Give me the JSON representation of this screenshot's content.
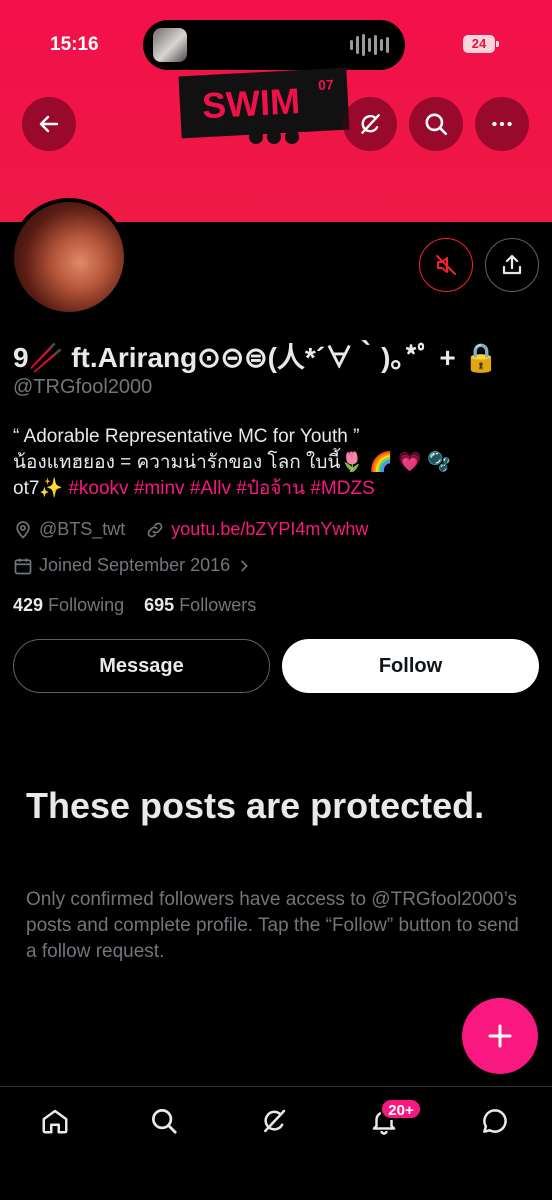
{
  "status_bar": {
    "time": "15:16",
    "battery": "24"
  },
  "banner": {
    "logo_text": "SWIM",
    "logo_sup": "07"
  },
  "profile": {
    "name": "9🥢 ft.Arirang⊙⊝⊜(人*´∀｀)｡*ﾟ + 🔒",
    "handle": "@TRGfool2000",
    "bio_line1": "“ Adorable Representative MC for Youth ”",
    "bio_line2": "น้องแทฮยอง = ความน่ารักของ โลก ใบนี้🌷 🌈 💗 🫧",
    "bio_line3_prefix": "ot7✨ ",
    "bio_tags": "#kookv #minv #Allv #ป๋อจ้าน #MDZS",
    "location": "@BTS_twt",
    "website": "youtu.be/bZYPI4mYwhw",
    "joined": "Joined September 2016",
    "following_count": "429",
    "following_label": "Following",
    "followers_count": "695",
    "followers_label": "Followers"
  },
  "buttons": {
    "message": "Message",
    "follow": "Follow"
  },
  "protected": {
    "title": "These posts are protected.",
    "body": "Only confirmed followers have access to @TRGfool2000’s posts and complete profile. Tap the “Follow” button to send a follow request."
  },
  "tabbar": {
    "notifications_badge": "20+"
  },
  "colors": {
    "accent": "#f91880",
    "banner": "#f0104a",
    "muted": "#71767b"
  }
}
